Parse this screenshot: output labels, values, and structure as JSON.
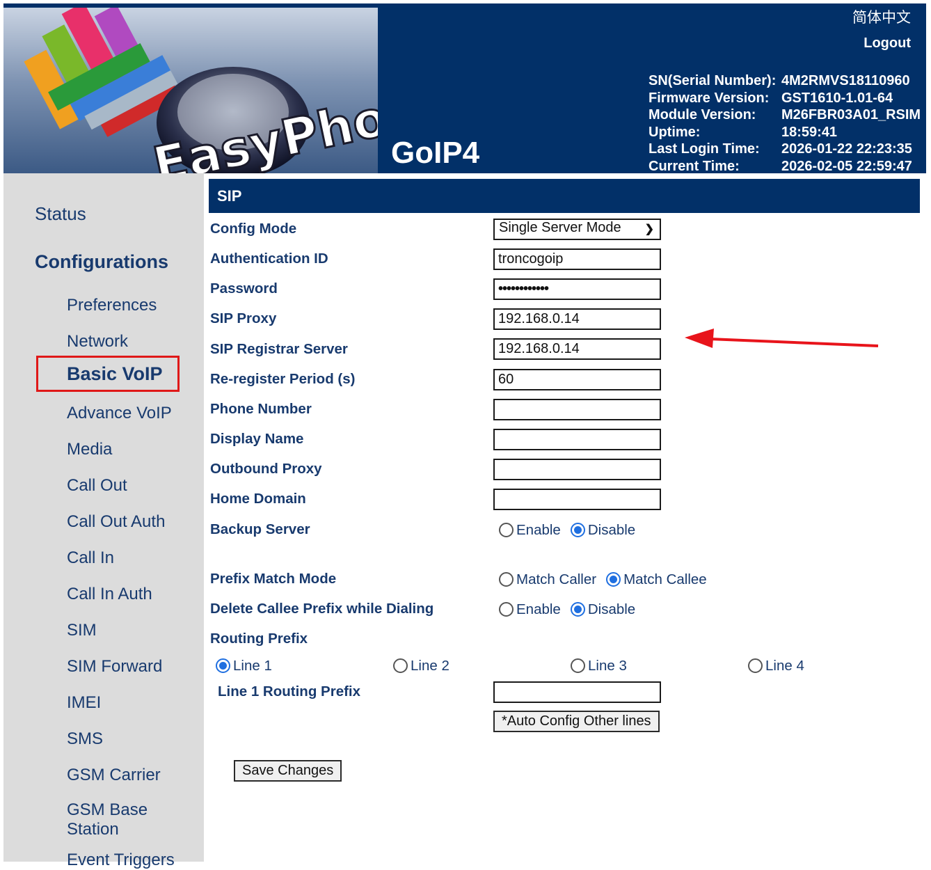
{
  "header": {
    "logo_text": "EasyPhone",
    "product_name": "GoIP4",
    "language_link": "简体中文",
    "logout_link": "Logout",
    "system_info": [
      {
        "key": "SN(Serial Number):",
        "value": "4M2RMVS18110960"
      },
      {
        "key": "Firmware Version:",
        "value": "GST1610-1.01-64"
      },
      {
        "key": "Module Version:",
        "value": "M26FBR03A01_RSIM"
      },
      {
        "key": "Uptime:",
        "value": "18:59:41"
      },
      {
        "key": "Last Login Time:",
        "value": "2026-01-22 22:23:35"
      },
      {
        "key": "Current Time:",
        "value": "2026-02-05 22:59:47"
      }
    ]
  },
  "sidebar": {
    "status": "Status",
    "configurations": "Configurations",
    "items": [
      "Preferences",
      "Network",
      "Basic VoIP",
      "Advance VoIP",
      "Media",
      "Call Out",
      "Call Out Auth",
      "Call In",
      "Call In Auth",
      "SIM",
      "SIM Forward",
      "IMEI",
      "SMS",
      "GSM Carrier",
      "GSM Base Station",
      "Event Triggers"
    ],
    "selected": "Basic VoIP"
  },
  "form": {
    "section_title": "SIP",
    "config_mode": {
      "label": "Config Mode",
      "value": "Single Server Mode"
    },
    "auth_id": {
      "label": "Authentication ID",
      "value": "troncogoip"
    },
    "password": {
      "label": "Password",
      "value": "••••••••••••"
    },
    "sip_proxy": {
      "label": "SIP Proxy",
      "value": "192.168.0.14"
    },
    "registrar": {
      "label": "SIP Registrar Server",
      "value": "192.168.0.14"
    },
    "reregister": {
      "label": "Re-register Period (s)",
      "value": "60"
    },
    "phone_number": {
      "label": "Phone Number",
      "value": ""
    },
    "display_name": {
      "label": "Display Name",
      "value": ""
    },
    "outbound_proxy": {
      "label": "Outbound Proxy",
      "value": ""
    },
    "home_domain": {
      "label": "Home Domain",
      "value": ""
    },
    "backup_server": {
      "label": "Backup Server",
      "options": [
        "Enable",
        "Disable"
      ],
      "selected": "Disable"
    },
    "prefix_match": {
      "label": "Prefix Match Mode",
      "options": [
        "Match Caller",
        "Match Callee"
      ],
      "selected": "Match Callee"
    },
    "delete_prefix": {
      "label": "Delete Callee Prefix while Dialing",
      "options": [
        "Enable",
        "Disable"
      ],
      "selected": "Disable"
    },
    "routing_prefix": {
      "label": "Routing Prefix",
      "lines": [
        "Line 1",
        "Line 2",
        "Line 3",
        "Line 4"
      ],
      "selected": "Line 1",
      "line_label": "Line 1 Routing Prefix",
      "value": ""
    },
    "auto_config_button": "*Auto Config Other lines",
    "save_button": "Save Changes"
  },
  "annotation": {
    "arrow_color": "#e8141b",
    "highlight_color": "#e01818"
  }
}
